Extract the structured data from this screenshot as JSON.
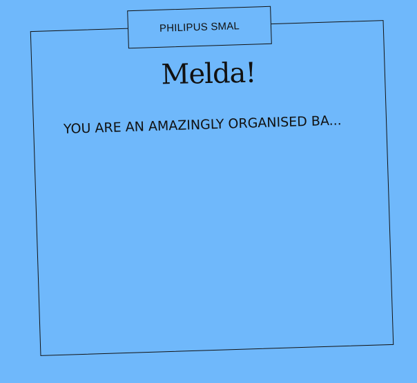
{
  "card": {
    "sender": "PHILIPUS SMAL",
    "recipient": "Melda!",
    "message": "YOU ARE AN AMAZINGLY ORGANISED BA..."
  },
  "colors": {
    "background": "#6FB8FB",
    "ink": "#111111"
  }
}
